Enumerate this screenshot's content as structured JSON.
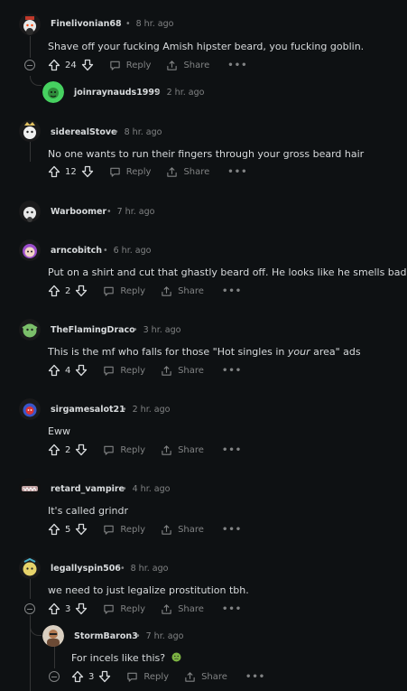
{
  "actions": {
    "reply": "Reply",
    "share": "Share",
    "more": "•••"
  },
  "separator": "•",
  "comments": [
    {
      "username": "Finelivonian68",
      "time": "8 hr. ago",
      "body": "Shave off your fucking Amish hipster beard, you fucking goblin.",
      "score": "24"
    },
    {
      "username": "joinraynauds1999",
      "time": "2 hr. ago"
    },
    {
      "username": "siderealStove",
      "time": "8 hr. ago",
      "body": "No one wants to run their fingers through your gross beard hair",
      "score": "12"
    },
    {
      "username": "Warboomer",
      "time": "7 hr. ago"
    },
    {
      "username": "arncobitch",
      "time": "6 hr. ago",
      "body": "Put on a shirt and cut that ghastly beard off. He looks like he smells bad.",
      "score": "2"
    },
    {
      "username": "TheFlamingDraco",
      "time": "3 hr. ago",
      "body_pre": "This is the mf who falls for those \"Hot singles in ",
      "body_em": "your",
      "body_post": " area\" ads",
      "score": "4"
    },
    {
      "username": "sirgamesalot21",
      "time": "2 hr. ago",
      "body": "Eww",
      "score": "2"
    },
    {
      "username": "retard_vampire",
      "time": "4 hr. ago",
      "body": "It's called grindr",
      "score": "5"
    },
    {
      "username": "legallyspin506",
      "time": "8 hr. ago",
      "body": "we need to just legalize prostitution tbh.",
      "score": "3"
    },
    {
      "username": "StormBaron3",
      "time": "7 hr. ago",
      "body": "For incels like this?",
      "score": "3",
      "emoji": "nauseated-face-emoji"
    }
  ]
}
